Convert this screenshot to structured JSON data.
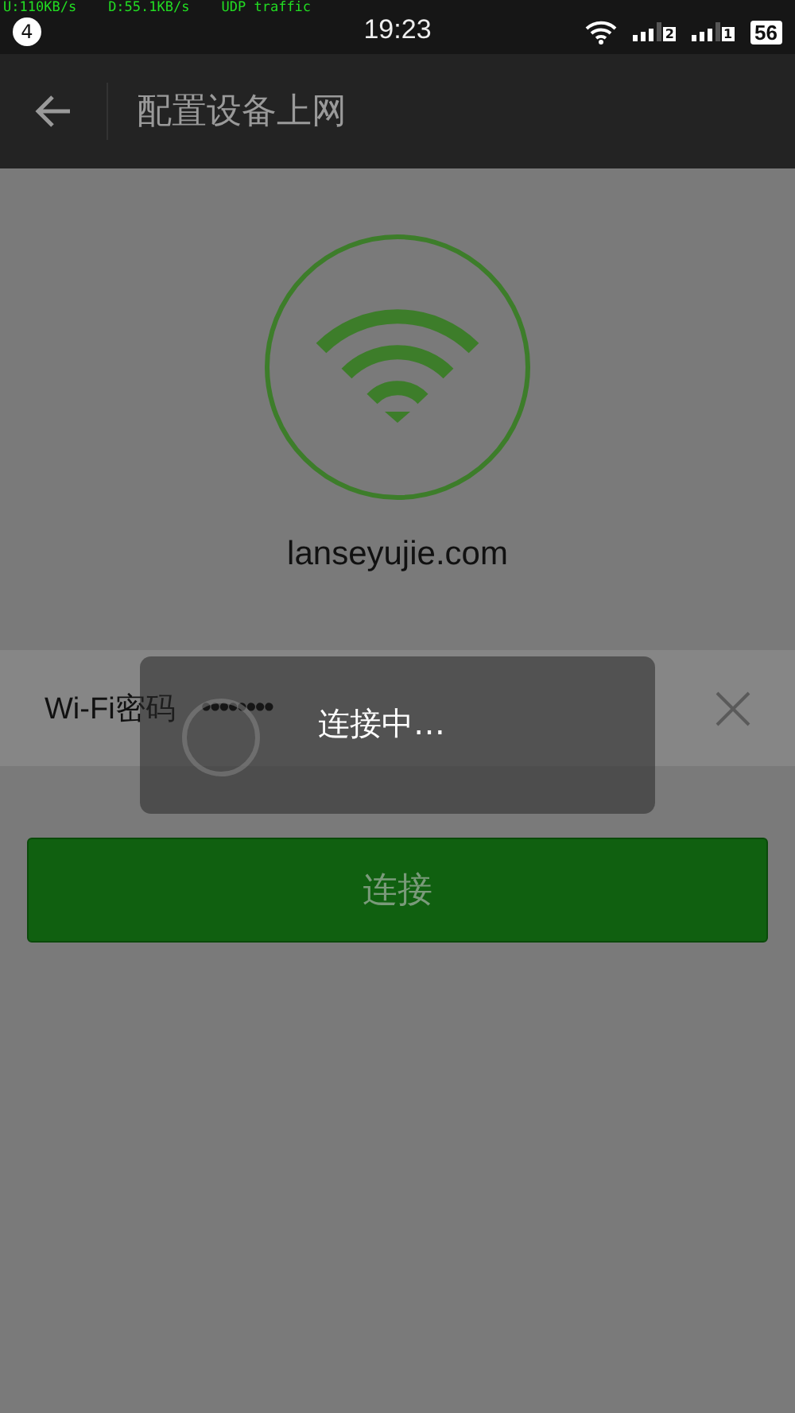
{
  "status_bar": {
    "notification_count": "4",
    "upload": "U:110KB/s",
    "download": "D:55.1KB/s",
    "traffic": "UDP traffic",
    "time": "19:23",
    "sim_1": "2",
    "sim_2": "1",
    "battery": "56"
  },
  "header": {
    "title": "配置设备上网"
  },
  "network": {
    "ssid": "lanseyujie.com"
  },
  "password": {
    "label": "Wi-Fi密码",
    "value": "••••••••"
  },
  "connect_button": {
    "label": "连接",
    "disabled": true
  },
  "dialog": {
    "message": "连接中…"
  }
}
